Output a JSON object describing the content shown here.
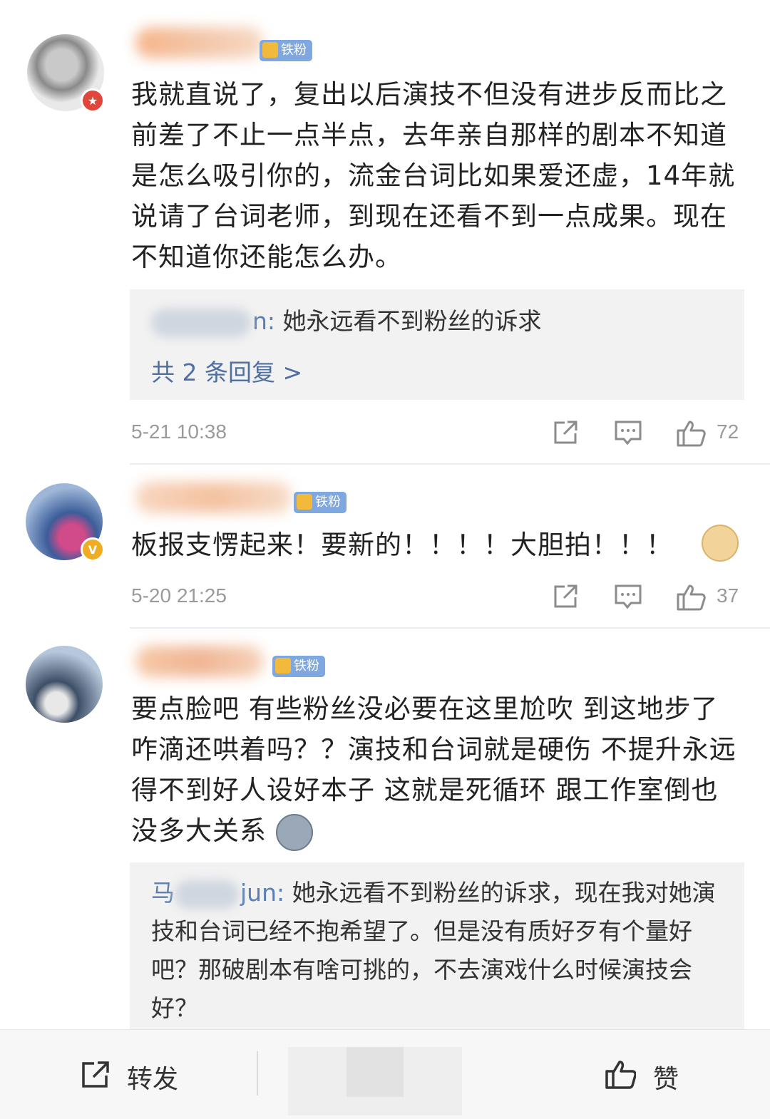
{
  "comments": [
    {
      "body": "我就直说了，复出以后演技不但没有进步反而比之前差了不止一点半点，去年亲自那样的剧本不知道是怎么吸引你的，流金台词比如果爱还虚，14年就说请了台词老师，到现在还看不到一点成果。现在不知道你还能怎么办。",
      "badge": "铁粉",
      "reply": {
        "name_suffix": "n:",
        "text": "她永远看不到粉丝的诉求"
      },
      "more_replies": "共 2 条回复 >",
      "time": "5-21 10:38",
      "likes": "72"
    },
    {
      "body": "板报支愣起来！要新的！！！！大胆拍！！！",
      "badge": "铁粉",
      "time": "5-20 21:25",
      "likes": "37"
    },
    {
      "body": "要点脸吧 有些粉丝没必要在这里尬吹 到这地步了咋滴还哄着吗？？演技和台词就是硬伤 不提升永远得不到好人设好本子 这就是死循环 跟工作室倒也没多大关系",
      "badge": "铁粉",
      "reply": {
        "name_prefix": "马",
        "name_suffix": "jun:",
        "text": "她永远看不到粉丝的诉求，现在我对她演技和台词已经不抱希望了。但是没有质好歹有个量好吧？那破剧本有啥可挑的，不去演戏什么时候演技会好？"
      }
    }
  ],
  "toolbar": {
    "repost": "转发",
    "like": "赞"
  },
  "colors": {
    "link": "#5b7fb0",
    "muted": "#9a9a9a",
    "badge": "#7fa8e0"
  }
}
